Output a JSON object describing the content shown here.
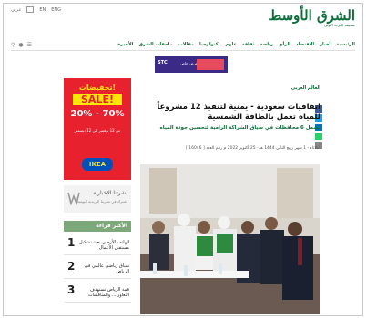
{
  "header": {
    "utility": [
      "عربي",
      "EN",
      "ENG"
    ],
    "logo_main": "الشرق الأوسط",
    "logo_sub": "صحيفة العرب الأولى"
  },
  "nav": {
    "items": [
      "الرئيسية",
      "أخبار",
      "الاقتصاد",
      "الرأي",
      "رياضة",
      "ثقافة",
      "علوم",
      "تكنولوجيا",
      "مقالات",
      "ملحقات الشرق",
      "الأخيرة"
    ],
    "icons": [
      "search-icon",
      "user-icon",
      "menu-icon"
    ]
  },
  "banner": {
    "label": "STC",
    "text": "عرض خاص"
  },
  "ad": {
    "headline": "تخفيضات!",
    "sale": "SALE!",
    "percent": "20% - 70%",
    "note": "من 12 نوفمبر إلى 12 ديسمبر",
    "brand": "IKEA"
  },
  "newsletter": {
    "title": "نشرتنا الإخبارية",
    "subtitle": "اشترك في نشرتنا البريدية اليومية"
  },
  "most_read": {
    "heading": "الأكثر قراءة",
    "items": [
      {
        "num": "1",
        "text": "الهاتف الأرضي يعيد تشكيل مستقبل الأعمال"
      },
      {
        "num": "2",
        "text": "سباق رياضي عالمي في الرياض"
      },
      {
        "num": "3",
        "text": "قمة الرياض تستهدف التعاون... والمناقشات"
      }
    ]
  },
  "article": {
    "breadcrumb": "العالم العربي",
    "title": "اتفاقيات سعودية - يمنية لتنفيذ 12 مشروعاً للمياه تعمل بالطاقة الشمسية",
    "subtitle": "تشمل 6 محافظات في سياق الشراكة الرامية لتحسين جودة المياه",
    "meta": "الثلاثاء - 1 شهر ربيع الثاني 1444 هـ - 25 أكتوبر 2022 م رقم العدد [ 16046 ]",
    "share_colors": [
      "#3b5998",
      "#1da1f2",
      "#0077b5",
      "#25d366",
      "#888888"
    ]
  }
}
